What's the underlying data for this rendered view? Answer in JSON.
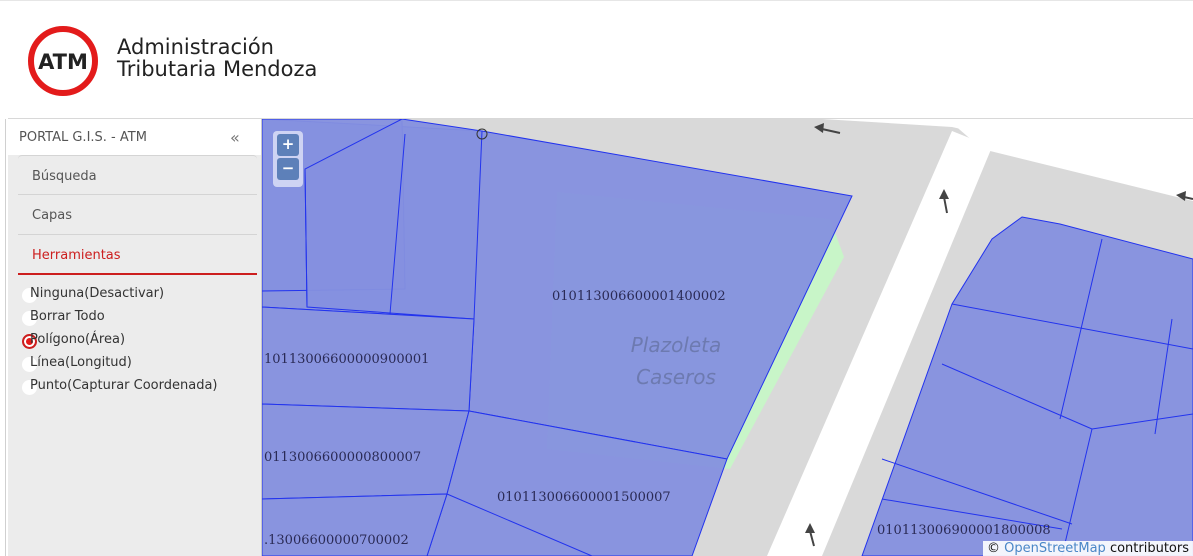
{
  "header": {
    "logo_text": "ATM",
    "brand_line1": "Administración",
    "brand_line2": "Tributaria Mendoza"
  },
  "sidebar": {
    "title": "PORTAL G.I.S. - ATM",
    "collapse_glyph": "«",
    "splitter_glyph": "‹",
    "sections": [
      {
        "label": "Búsqueda"
      },
      {
        "label": "Capas"
      },
      {
        "label": "Herramientas"
      }
    ],
    "tools": [
      {
        "label": "Ninguna(Desactivar)",
        "checked": false
      },
      {
        "label": "Borrar Todo",
        "checked": false
      },
      {
        "label": "Polígono(Área)",
        "checked": true
      },
      {
        "label": "Línea(Longitud)",
        "checked": false
      },
      {
        "label": "Punto(Capturar Coordenada)",
        "checked": false
      }
    ]
  },
  "map": {
    "zoom_in": "+",
    "zoom_out": "−",
    "place_name_1": "Plazoleta",
    "place_name_2": "Caseros",
    "parcels": [
      "010113006600001400002",
      "10113006600000900001",
      "0113006600000800007",
      "010113006600001500007",
      ".13006600000700002",
      "010113006900001800008"
    ],
    "attribution_prefix": "© ",
    "attribution_link": "OpenStreetMap",
    "attribution_suffix": " contributors",
    "colors": {
      "parcel_fill": "#8590df",
      "parcel_stroke": "#2233ee",
      "street": "#d9d9d9",
      "road": "#ffffff",
      "park": "#c8f5c8",
      "accent": "#cc1e1e"
    }
  }
}
